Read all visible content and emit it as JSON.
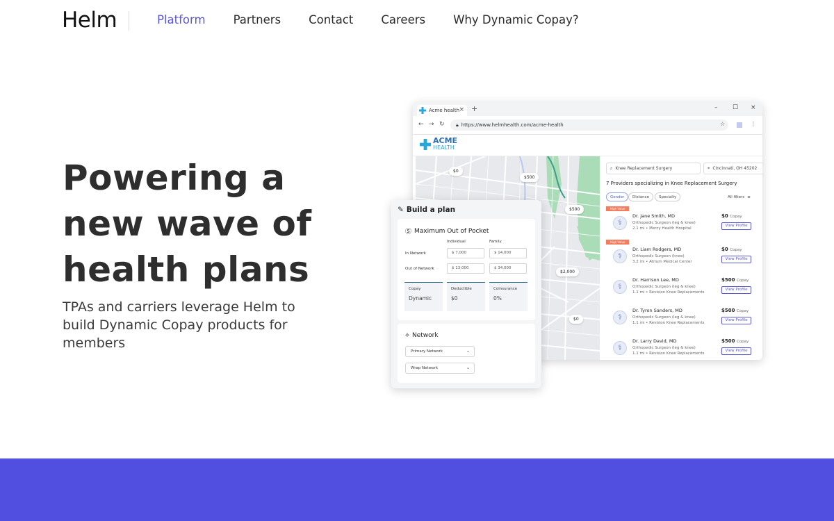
{
  "nav": {
    "logo": "Helm",
    "links": [
      "Platform",
      "Partners",
      "Contact",
      "Careers",
      "Why Dynamic Copay?"
    ]
  },
  "hero": {
    "title": "Powering a new wave of health plans",
    "subtitle": "TPAs and carriers leverage Helm to build Dynamic Copay products for members"
  },
  "browser": {
    "tab_title": "Acme health",
    "tab_plus": "+",
    "url": "https://www.helmhealth.com/acme-health",
    "site_logo_top": "ACME",
    "site_logo_bottom": "HEALTH",
    "map_pins": [
      "$0",
      "$500",
      "$500",
      "$2,000",
      "$0"
    ],
    "search": {
      "procedure": "Knee Replacement Surgery",
      "location": "Cincinnati, OH 45202"
    },
    "results_count": "7 Providers specializing in Knee Replacement Surgery",
    "filters": [
      "Gender",
      "Distance",
      "Specialty"
    ],
    "all_filters": "All filters",
    "providers": [
      {
        "badge": "High Value",
        "name": "Dr. Jane Smith, MD",
        "specialty": "Orthopedic Surgeon (leg & knee)",
        "distance": "2.1 mi  •  Mercy Health Hospital",
        "price": "$0",
        "price_unit": "Copay",
        "button": "View Profile"
      },
      {
        "badge": "High Value",
        "name": "Dr. Liam Rodgers, MD",
        "specialty": "Orthopedic Surgeon (knee)",
        "distance": "3.2 mi  •  Atrium Medical Center",
        "price": "$0",
        "price_unit": "Copay",
        "button": "View Profile"
      },
      {
        "badge": "",
        "name": "Dr. Harrison Lee, MD",
        "specialty": "Orthopedic Surgeon (leg & knee)",
        "distance": "1.1 mi  •  Revision Knee Replacements",
        "price": "$500",
        "price_unit": "Copay",
        "button": "View Profile"
      },
      {
        "badge": "",
        "name": "Dr. Tyron Sanders, MD",
        "specialty": "Orthopedic Surgeon (leg & knee)",
        "distance": "1.1 mi  •  Revision Knee Replacements",
        "price": "$500",
        "price_unit": "Copay",
        "button": "View Profile"
      },
      {
        "badge": "",
        "name": "Dr. Larry David, MD",
        "specialty": "Orthopedic Surgeon (leg & knee)",
        "distance": "1.1 mi  •  Revision Knee Replacements",
        "price": "$500",
        "price_unit": "Copay",
        "button": "View Profile"
      }
    ]
  },
  "plan": {
    "title": "Build a plan",
    "oop": {
      "title": "Maximum Out of Pocket",
      "col_individual": "Individual",
      "col_family": "Family",
      "in_network_label": "In Network",
      "out_network_label": "Out of Network",
      "in_individual": "$  7,000",
      "in_family": "$  14,000",
      "out_individual": "$  13,000",
      "out_family": "$  34,000"
    },
    "stats": [
      {
        "label": "Copay",
        "value": "Dynamic"
      },
      {
        "label": "Deductible",
        "value": "$0"
      },
      {
        "label": "Coinsurance",
        "value": "0%"
      }
    ],
    "network": {
      "title": "Network",
      "primary": "Primary Network",
      "wrap": "Wrap Network"
    }
  },
  "colors": {
    "accent": "#5b58d6",
    "band": "#514fdf",
    "badge": "#f27c5c"
  }
}
